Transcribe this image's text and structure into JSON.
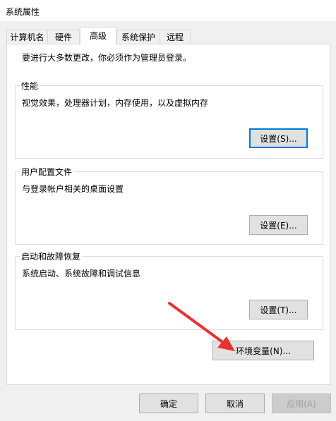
{
  "window": {
    "title": "系统属性"
  },
  "tabs": [
    {
      "label": "计算机名",
      "active": false
    },
    {
      "label": "硬件",
      "active": false
    },
    {
      "label": "高级",
      "active": true
    },
    {
      "label": "系统保护",
      "active": false
    },
    {
      "label": "远程",
      "active": false
    }
  ],
  "advanced": {
    "admin_note": "要进行大多数更改，你必须作为管理员登录。",
    "performance": {
      "title": "性能",
      "description": "视觉效果，处理器计划，内存使用，以及虚拟内存",
      "button": "设置(S)..."
    },
    "user_profiles": {
      "title": "用户配置文件",
      "description": "与登录帐户相关的桌面设置",
      "button": "设置(E)..."
    },
    "startup_recovery": {
      "title": "启动和故障恢复",
      "description": "系统启动、系统故障和调试信息",
      "button": "设置(T)..."
    },
    "env_button": "环境变量(N)..."
  },
  "footer": {
    "ok": "确定",
    "cancel": "取消",
    "apply": "应用(A)"
  },
  "colors": {
    "focus_border": "#0078d7",
    "annotation_arrow": "#e8322e"
  }
}
